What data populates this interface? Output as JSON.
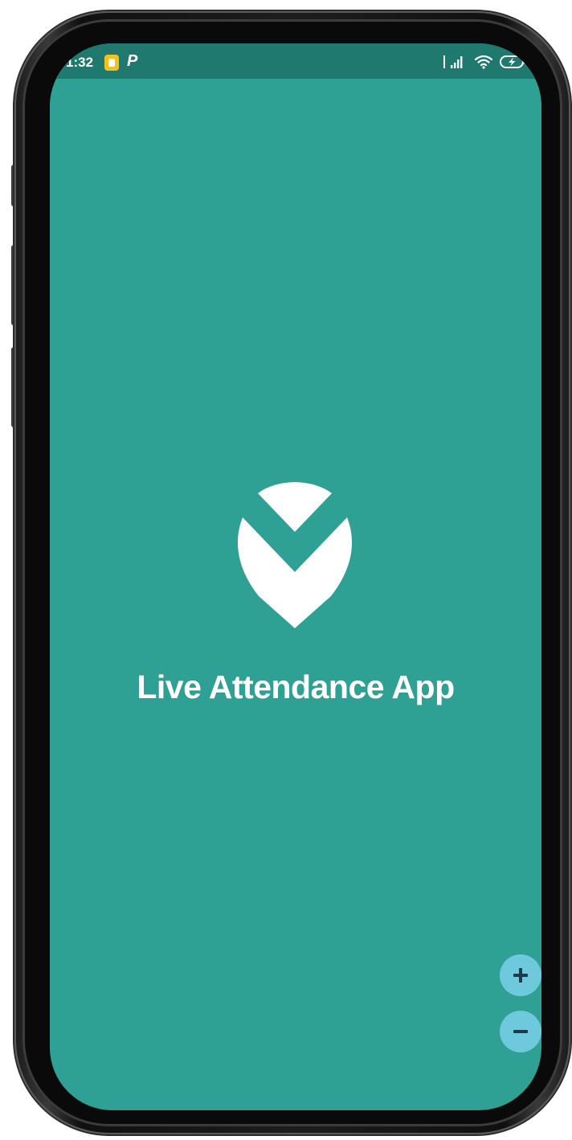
{
  "status_bar": {
    "time": "1:32",
    "left_icons": [
      "notification-badge-icon",
      "p-app-icon"
    ],
    "p_label": "P",
    "right_icons": [
      "signal-icon",
      "wifi-icon",
      "battery-charging-icon"
    ]
  },
  "splash": {
    "logo_icon": "location-pin-check-logo-icon",
    "title": "Live Attendance App"
  },
  "zoom_controls": {
    "zoom_in_icon": "plus-icon",
    "zoom_out_icon": "minus-icon"
  },
  "colors": {
    "screen_background": "#2fa094",
    "status_bar_background": "#20796f",
    "zoom_button": "#6fc9dc",
    "text": "#ffffff"
  }
}
